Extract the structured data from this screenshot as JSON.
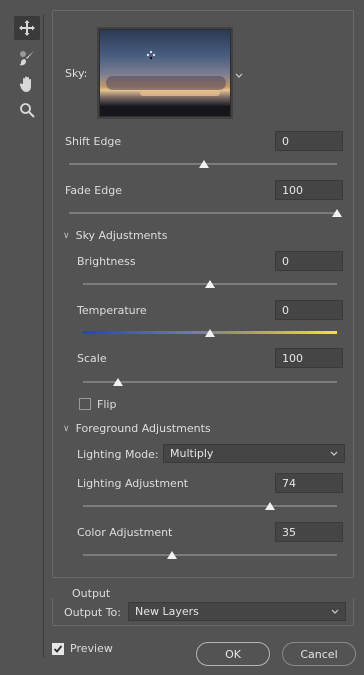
{
  "tools": [
    {
      "name": "move-tool",
      "icon": "move-icon",
      "active": true
    },
    {
      "name": "sky-brush-tool",
      "icon": "brush-icon",
      "active": false
    },
    {
      "name": "hand-tool",
      "icon": "hand-icon",
      "active": false
    },
    {
      "name": "zoom-tool",
      "icon": "zoom-icon",
      "active": false
    }
  ],
  "sky": {
    "label": "Sky:"
  },
  "shift_edge": {
    "label": "Shift Edge",
    "value": "0",
    "slider": 0.47
  },
  "fade_edge": {
    "label": "Fade Edge",
    "value": "100",
    "slider": 1.0
  },
  "sky_adjustments": {
    "title": "Sky Adjustments",
    "brightness": {
      "label": "Brightness",
      "value": "0",
      "slider": 0.5
    },
    "temperature": {
      "label": "Temperature",
      "value": "0",
      "slider": 0.5
    },
    "scale": {
      "label": "Scale",
      "value": "100",
      "slider": 0.14
    },
    "flip": {
      "label": "Flip",
      "checked": false
    }
  },
  "foreground_adjustments": {
    "title": "Foreground Adjustments",
    "lighting_mode": {
      "label": "Lighting Mode:",
      "value": "Multiply"
    },
    "lighting_adjustment": {
      "label": "Lighting Adjustment",
      "value": "74",
      "slider": 0.74
    },
    "color_adjustment": {
      "label": "Color Adjustment",
      "value": "35",
      "slider": 0.35
    }
  },
  "output": {
    "title": "Output",
    "output_to_label": "Output To:",
    "output_to_value": "New Layers"
  },
  "preview": {
    "label": "Preview",
    "checked": true
  },
  "buttons": {
    "ok": "OK",
    "cancel": "Cancel"
  }
}
